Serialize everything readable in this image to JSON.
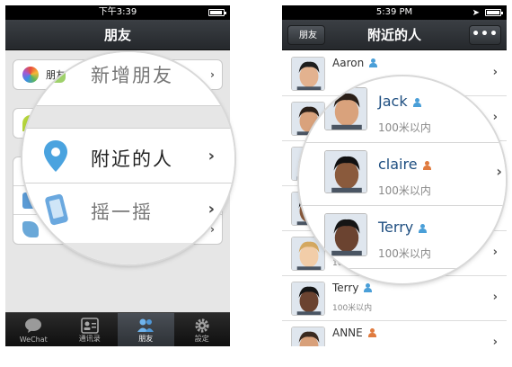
{
  "left_phone": {
    "status": {
      "time": "下午3:39",
      "battery_level": 0.8
    },
    "title": "朋友",
    "menu": [
      {
        "label": "朋友",
        "icon": "color-wheel-icon"
      },
      {
        "label": "",
        "icon": "leaf-icon"
      },
      {
        "label": "",
        "icon": "location-pin-icon"
      },
      {
        "label": "",
        "icon": "shake-phone-icon"
      },
      {
        "label": "",
        "icon": "bottle-icon"
      }
    ],
    "magnifier": {
      "rows": [
        {
          "label": "新增朋友",
          "icon": "add-friend-icon"
        },
        {
          "label": "附近的人",
          "icon": "location-pin-icon"
        },
        {
          "label": "摇一摇",
          "icon": "shake-phone-icon"
        }
      ]
    },
    "tabs": [
      {
        "label": "WeChat",
        "icon": "chat-bubble-icon",
        "active": false
      },
      {
        "label": "通讯录",
        "icon": "contacts-card-icon",
        "active": false
      },
      {
        "label": "朋友",
        "icon": "friends-icon",
        "active": true
      },
      {
        "label": "設定",
        "icon": "gear-icon",
        "active": false
      }
    ]
  },
  "right_phone": {
    "status": {
      "time": "5:39 PM",
      "battery_level": 0.9
    },
    "title": "附近的人",
    "back_label": "朋友",
    "more_label": "•••",
    "colors": {
      "male": "#4a9fd8",
      "female": "#e07b3f",
      "name_blue": "#1e4e80"
    },
    "people": [
      {
        "name": "Aaron",
        "gender": "male",
        "distance": ""
      },
      {
        "name": "",
        "gender": "male",
        "distance": ""
      },
      {
        "name": "",
        "gender": "female",
        "distance": ""
      },
      {
        "name": "",
        "gender": "male",
        "distance": ""
      },
      {
        "name": "Cla",
        "gender": "female",
        "distance": "100米以内"
      },
      {
        "name": "Terry",
        "gender": "male",
        "distance": "100米以内"
      },
      {
        "name": "ANNE",
        "gender": "female",
        "distance": ""
      }
    ],
    "magnifier": {
      "people": [
        {
          "name": "Jack",
          "gender": "male",
          "distance": "100米以内"
        },
        {
          "name": "claire",
          "gender": "female",
          "distance": "100米以内"
        },
        {
          "name": "Terry",
          "gender": "male",
          "distance": "100米以内"
        }
      ]
    }
  }
}
